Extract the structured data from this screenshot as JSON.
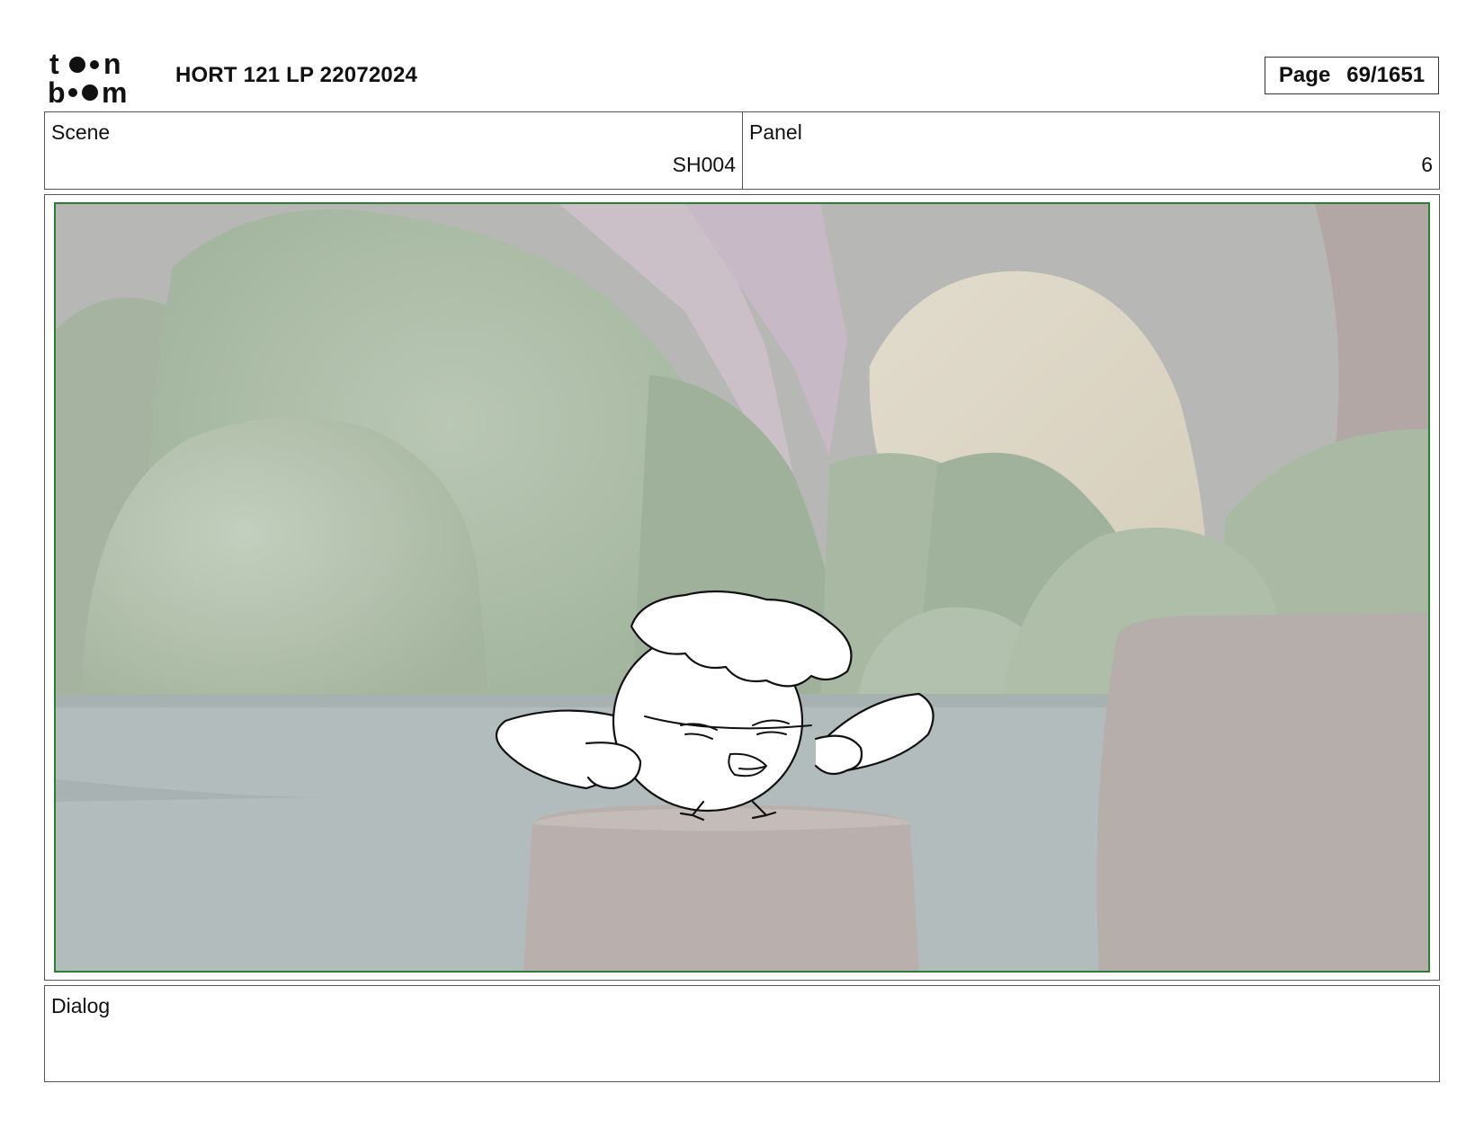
{
  "header": {
    "brand_top": "toon",
    "brand_bottom": "boom",
    "title": "HORT 121 LP 22072024",
    "page_label": "Page",
    "page_value": "69/1651"
  },
  "scene": {
    "label": "Scene",
    "value": "SH004"
  },
  "panel": {
    "label": "Panel",
    "value": "6"
  },
  "dialog": {
    "label": "Dialog",
    "text": ""
  },
  "colors": {
    "safe_frame": "#2e7d32",
    "border": "#555555"
  }
}
